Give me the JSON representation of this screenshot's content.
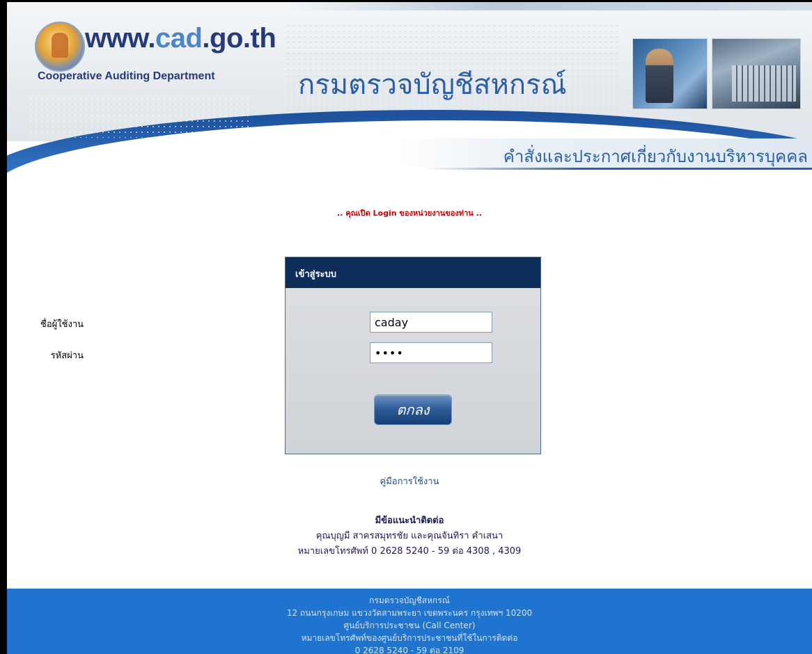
{
  "header": {
    "url_part1": "www.",
    "url_accent": "cad",
    "url_part2": ".go.th",
    "department_en": "Cooperative Auditing Department",
    "title_th": "กรมตรวจบัญชีสหกรณ์",
    "subtitle_th": "คำสั่งและประกาศเกี่ยวกับงานบริหารบุคคล"
  },
  "notice": ".. คุณเปิด Login ของหน่วยงานของท่าน ..",
  "login": {
    "title": "เข้าสู่ระบบ",
    "username_label": "ชื่อผู้ใช้งาน",
    "username_value": "caday",
    "password_label": "รหัสผ่าน",
    "password_value": "1234",
    "submit_label": "ตกลง"
  },
  "manual_link": "คู่มือการใช้งาน",
  "contact": {
    "title": "มีข้อแนะนำติดต่อ",
    "names": "คุณบุญมี สาครสมุทรชัย และคุณจันทิรา คำเสนา",
    "phone": "หมายเลขโทรศัพท์ 0 2628 5240 - 59 ต่อ 4308 , 4309"
  },
  "footer": {
    "line1": "กรมตรวจบัญชีสหกรณ์",
    "line2": "12 ถนนกรุงเกษม แขวงวัดสามพระยา เขตพระนคร กรุงเทพฯ 10200",
    "line3": "ศูนย์บริการประชาชน (Call Center)",
    "line4": "หมายเลขโทรศัพท์ของศูนย์บริการประชาชนที่ใช้ในการติดต่อ",
    "line5": "0 2628 5240 - 59 ต่อ 2109"
  },
  "colors": {
    "brand_dark": "#243a7a",
    "brand_blue": "#2a5fa8",
    "panel_header": "#0e2e5a",
    "footer_bg": "#1f74d0",
    "notice_red": "#cc0000"
  }
}
